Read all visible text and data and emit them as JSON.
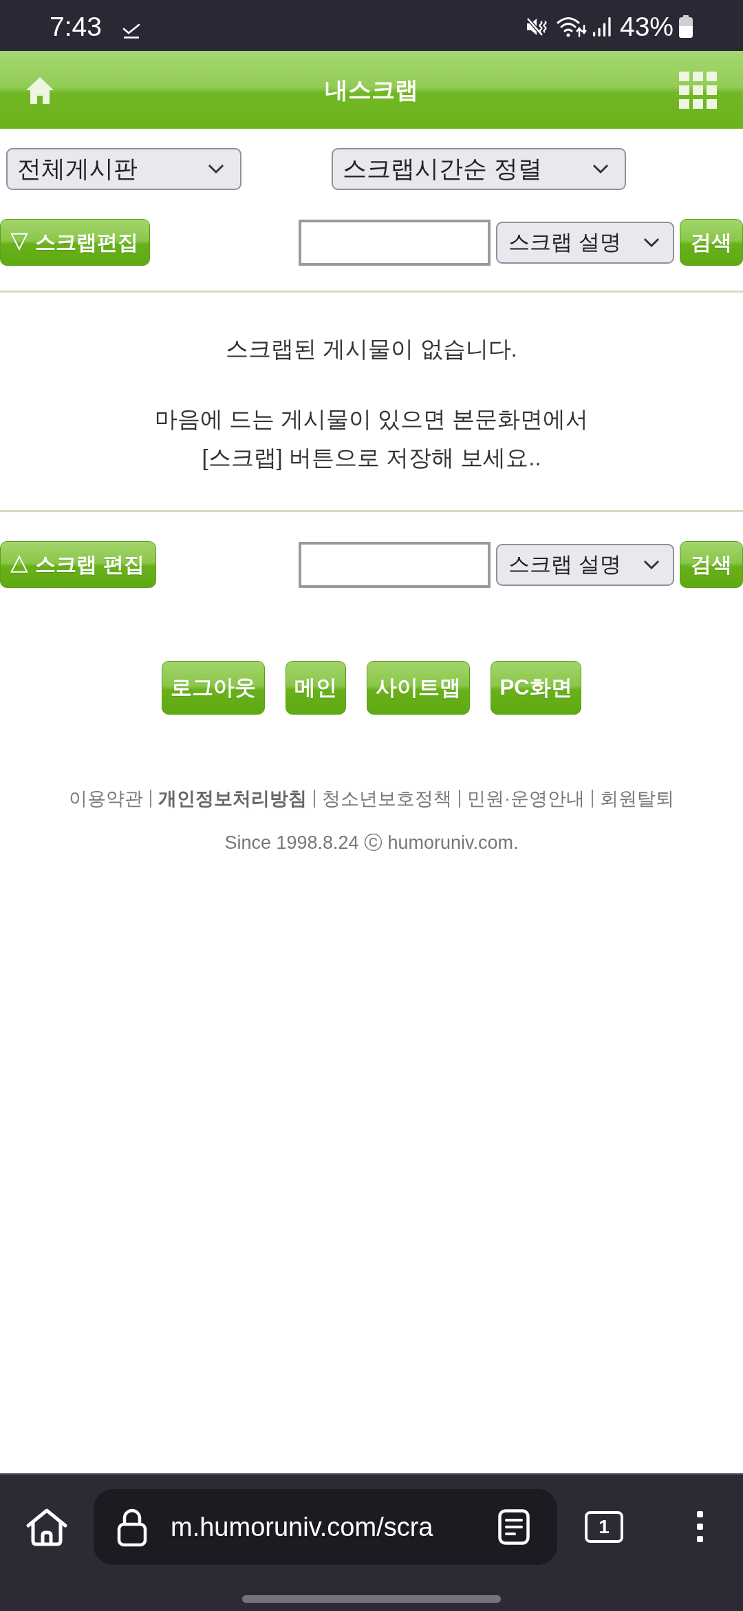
{
  "status_bar": {
    "time": "7:43",
    "battery": "43%"
  },
  "header": {
    "title": "내스크랩"
  },
  "filters": [
    {
      "value": "전체게시판"
    },
    {
      "value": "스크랩시간순 정렬"
    }
  ],
  "top_toolbar": {
    "edit_button": "▽ 스크랩편집",
    "search_scope": "스크랩 설명",
    "search_button": "검색"
  },
  "empty_notice": {
    "message": "스크랩된 게시물이 없습니다.",
    "hint": "마음에 드는 게시물이 있으면 본문화면에서\n[스크랩] 버튼으로 저장해 보세요.."
  },
  "bottom_toolbar": {
    "edit_button": "△ 스크랩 편집",
    "search_scope": "스크랩 설명",
    "search_button": "검색"
  },
  "footer": {
    "buttons": [
      "로그아웃",
      "메인",
      "사이트맵",
      "PC화면"
    ],
    "links": [
      {
        "label": "이용약관",
        "bold": false
      },
      {
        "label": "개인정보처리방침",
        "bold": true
      },
      {
        "label": "청소년보호정책",
        "bold": false
      },
      {
        "label": "민원·운영안내",
        "bold": false
      },
      {
        "label": "회원탈퇴",
        "bold": false
      }
    ],
    "copyright": "Since 1998.8.24 ⓒ humoruniv.com."
  },
  "browser_bar": {
    "url": "m.humoruniv.com/scra",
    "tab_count": "1"
  }
}
